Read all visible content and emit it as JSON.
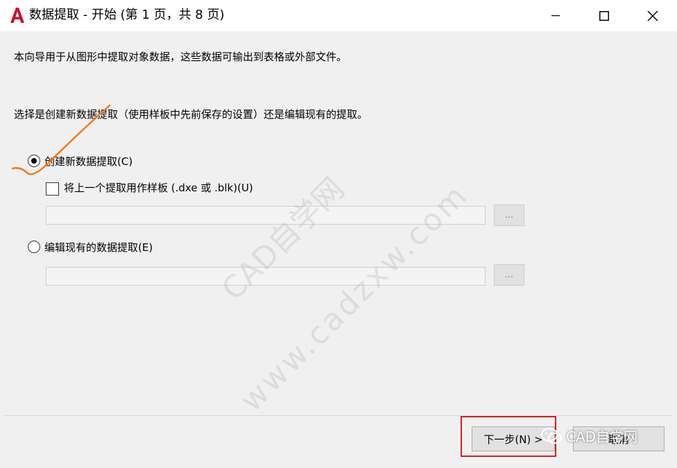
{
  "window": {
    "title": "数据提取 - 开始 (第 1 页，共 8 页)",
    "controls": [
      "minimize",
      "maximize",
      "close"
    ],
    "logo_icon": "autocad-a-icon"
  },
  "content": {
    "description": "本向导用于从图形中提取对象数据，这些数据可输出到表格或外部文件。",
    "instruction": "选择是创建新数据提取（使用样板中先前保存的设置）还是编辑现有的提取。",
    "options": {
      "create_new": {
        "label": "创建新数据提取(C)",
        "selected": true
      },
      "use_template": {
        "label": "将上一个提取用作样板  (.dxe 或 .blk)(U)",
        "checked": false
      },
      "template_path": {
        "value": "",
        "browse_label": "..."
      },
      "edit_existing": {
        "label": "编辑现有的数据提取(E)",
        "selected": false
      },
      "existing_path": {
        "value": "",
        "browse_label": "..."
      }
    }
  },
  "footer": {
    "next_label": "下一步(N) >",
    "cancel_label": "取消"
  },
  "overlay": {
    "watermark_line1": "CAD自学网",
    "watermark_line2": "www.cadzxw.com",
    "badge_text": "CAD自学网"
  },
  "colors": {
    "window_bg": "#f0f0f0",
    "titlebar_bg": "#ffffff",
    "logo_red": "#c8102e",
    "annotation_orange": "#f07a1a",
    "highlight_red": "#d32020"
  }
}
